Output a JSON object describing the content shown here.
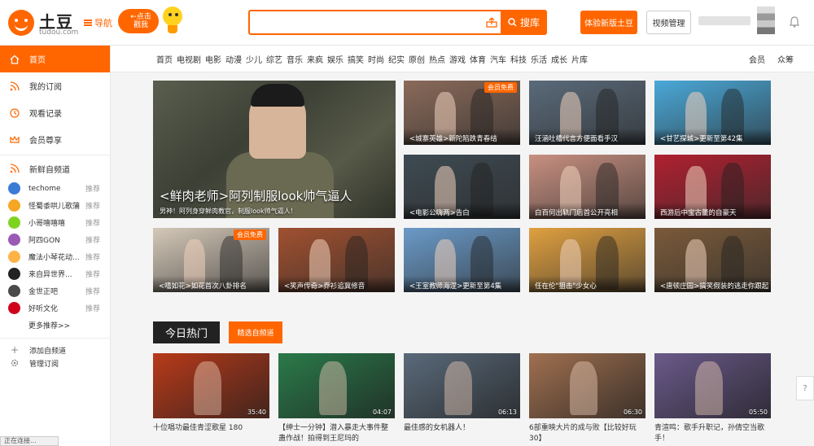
{
  "header": {
    "logo_text": "土豆",
    "logo_sub": "tudou.com",
    "nav_toggle": "导航",
    "promo_text": "←点击戳我",
    "search_placeholder": "",
    "search_button": "搜库",
    "btn_experience": "体验新版土豆",
    "btn_video_manage": "视频管理"
  },
  "navbar": {
    "items": [
      "首页",
      "电视剧",
      "电影",
      "动漫",
      "少儿",
      "综艺",
      "音乐",
      "来疯",
      "娱乐",
      "搞笑",
      "时尚",
      "纪实",
      "原创",
      "热点",
      "游戏",
      "体育",
      "汽车",
      "科技",
      "乐活",
      "成长",
      "片库"
    ],
    "right": [
      "会员",
      "众筹"
    ]
  },
  "sidebar": {
    "home": "首页",
    "items": [
      "我的订阅",
      "观看记录",
      "会员尊享"
    ],
    "section_title": "新鲜自频道",
    "channels": [
      {
        "name": "techome",
        "rec": "推荐",
        "color": "#3a7bd5"
      },
      {
        "name": "怪蜀黍哄儿歌蒲",
        "rec": "推荐",
        "color": "#f5a623"
      },
      {
        "name": "小哥嘻嘻嘻",
        "rec": "推荐",
        "color": "#7ed321"
      },
      {
        "name": "阿四GON",
        "rec": "推荐",
        "color": "#9b59b6"
      },
      {
        "name": "魔法小琴花动...",
        "rec": "推荐",
        "color": "#ffb347"
      },
      {
        "name": "来自异世界...",
        "rec": "推荐",
        "color": "#222222"
      },
      {
        "name": "金世正吧",
        "rec": "推荐",
        "color": "#4a4a4a"
      },
      {
        "name": "好听文化",
        "rec": "推荐",
        "color": "#d0021b"
      }
    ],
    "more": "更多推荐>>",
    "add_channel": "添加自频道",
    "manage_sub": "管理订阅"
  },
  "hero": {
    "title": "<鲜肉老师>阿列制服look帅气逼人",
    "subtitle": "男神！阿列身穿鲜肉教官，制服look帅气逼人！"
  },
  "tiles": [
    {
      "caption": "<城寨英雄>新陀陷跌青春结",
      "badge": "会员免费",
      "bg": "#8a6a5a"
    },
    {
      "caption": "汪涵吐槽代言方便面看手汉",
      "badge": "",
      "bg": "#5a6a7a"
    },
    {
      "caption": "<甘艺探城>更新至第42集",
      "badge": "",
      "bg": "#4aa8d8"
    },
    {
      "caption": "<电影公嗨两>告白",
      "badge": "",
      "bg": "#3e4a52"
    },
    {
      "caption": "白百何出轨门后首公开亮相",
      "badge": "",
      "bg": "#c89080"
    },
    {
      "caption": "西游后中宝古董的自豪天",
      "badge": "",
      "bg": "#b02030"
    },
    {
      "caption": "<嘻如花>如花首次八卦排名",
      "badge": "会员免费",
      "bg": "#d4c8b8"
    },
    {
      "caption": "<笑声传奇>乔衫追冀修音",
      "badge": "",
      "bg": "#a05030"
    },
    {
      "caption": "<王室教师海涅>更新至第4集",
      "badge": "",
      "bg": "#6a9ac8"
    },
    {
      "caption": "任在伦\"狙击\"少女心",
      "badge": "",
      "bg": "#e0a040"
    },
    {
      "caption": "<唐顿庄园>搞笑假装的逃走你跟起",
      "badge": "",
      "bg": "#7a5a3a"
    }
  ],
  "hot": {
    "title": "今日热门",
    "button": "精选自频道",
    "videos": [
      {
        "title": "十位唱功最佳青涩歌星 180",
        "duration": "35:40",
        "bg": "#b83a1a"
      },
      {
        "title": "【绅士一分钟】潜入暴走大事件整蛊作战！拍得到王尼玛的",
        "duration": "04:07",
        "bg": "#2a7a4a"
      },
      {
        "title": "最佳感的女机器人！",
        "duration": "06:13",
        "bg": "#5a6a7a"
      },
      {
        "title": "6部重映大片的成与败【比较好玩30】",
        "duration": "06:30",
        "bg": "#a07050"
      },
      {
        "title": "青渲鸣：歌手升职记，孙倩空当歌手！",
        "duration": "05:50",
        "bg": "#6a5a8a"
      }
    ]
  },
  "help_tab": "?",
  "status": "正在连接..."
}
